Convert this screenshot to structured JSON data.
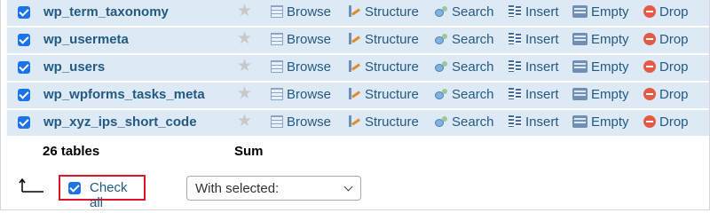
{
  "rows": [
    {
      "name": "wp_term_taxonomy"
    },
    {
      "name": "wp_usermeta"
    },
    {
      "name": "wp_users"
    },
    {
      "name": "wp_wpforms_tasks_meta"
    },
    {
      "name": "wp_xyz_ips_short_code"
    }
  ],
  "actions": {
    "browse": "Browse",
    "structure": "Structure",
    "search": "Search",
    "insert": "Insert",
    "empty": "Empty",
    "drop": "Drop"
  },
  "summary": {
    "count_label": "26 tables",
    "sum_label": "Sum"
  },
  "footer": {
    "check_all_label": "Check all",
    "check_all_checked": true,
    "with_selected_value": "With selected:"
  },
  "colors": {
    "row_bg": "#ddeaf6",
    "link": "#235a81",
    "checkbox": "#1a73e8",
    "highlight_border": "#e0122a"
  }
}
